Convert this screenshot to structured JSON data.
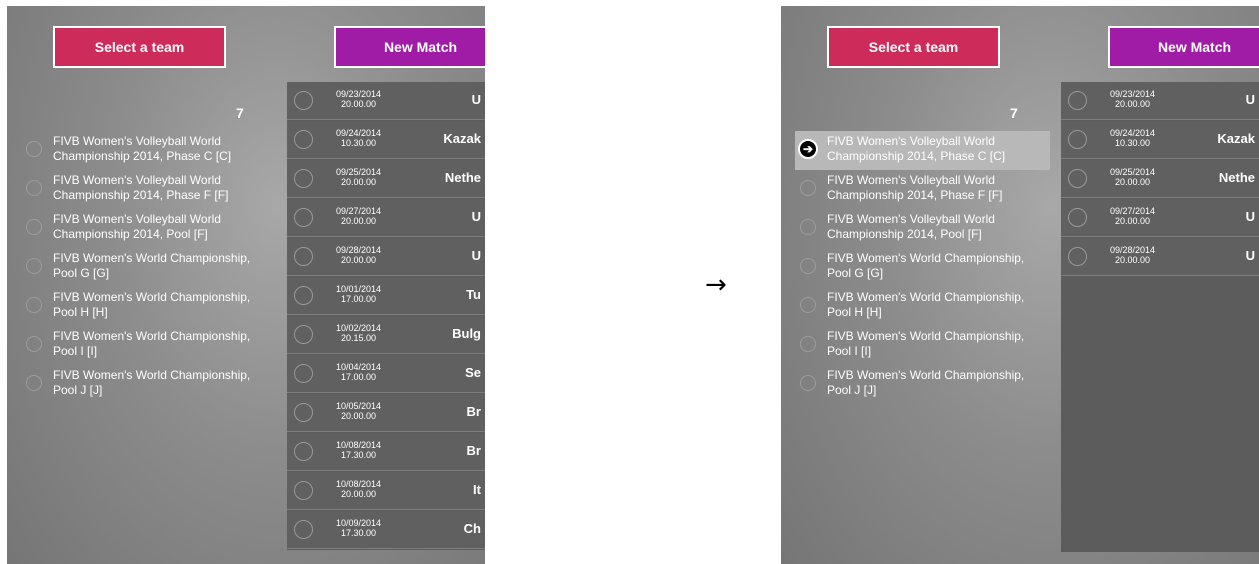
{
  "buttons": {
    "select_team": "Select a team",
    "new_match": "New Match"
  },
  "count": "7",
  "championships": [
    "FIVB Women's Volleyball World Championship 2014, Phase C [C]",
    "FIVB Women's Volleyball World Championship 2014, Phase F [F]",
    "FIVB Women's Volleyball World Championship 2014, Pool [F]",
    "FIVB Women's World Championship, Pool G [G]",
    "FIVB Women's World Championship, Pool H [H]",
    "FIVB Women's World Championship, Pool I [I]",
    "FIVB Women's World Championship, Pool J [J]"
  ],
  "selected_icon": "arrow-right-circle-icon",
  "arrow": "→",
  "matches_before": [
    {
      "date": "09/23/2014",
      "time": "20.00.00",
      "team": "U"
    },
    {
      "date": "09/24/2014",
      "time": "10.30.00",
      "team": "Kazak"
    },
    {
      "date": "09/25/2014",
      "time": "20.00.00",
      "team": "Nethe"
    },
    {
      "date": "09/27/2014",
      "time": "20.00.00",
      "team": "U"
    },
    {
      "date": "09/28/2014",
      "time": "20.00.00",
      "team": "U"
    },
    {
      "date": "10/01/2014",
      "time": "17.00.00",
      "team": "Tu"
    },
    {
      "date": "10/02/2014",
      "time": "20.15.00",
      "team": "Bulg"
    },
    {
      "date": "10/04/2014",
      "time": "17.00.00",
      "team": "Se"
    },
    {
      "date": "10/05/2014",
      "time": "20.00.00",
      "team": "Br"
    },
    {
      "date": "10/08/2014",
      "time": "17.30.00",
      "team": "Br"
    },
    {
      "date": "10/08/2014",
      "time": "20.00.00",
      "team": "It"
    },
    {
      "date": "10/09/2014",
      "time": "17.30.00",
      "team": "Ch"
    }
  ],
  "matches_after": [
    {
      "date": "09/23/2014",
      "time": "20.00.00",
      "team": "U"
    },
    {
      "date": "09/24/2014",
      "time": "10.30.00",
      "team": "Kazak"
    },
    {
      "date": "09/25/2014",
      "time": "20.00.00",
      "team": "Nethe"
    },
    {
      "date": "09/27/2014",
      "time": "20.00.00",
      "team": "U"
    },
    {
      "date": "09/28/2014",
      "time": "20.00.00",
      "team": "U"
    }
  ]
}
